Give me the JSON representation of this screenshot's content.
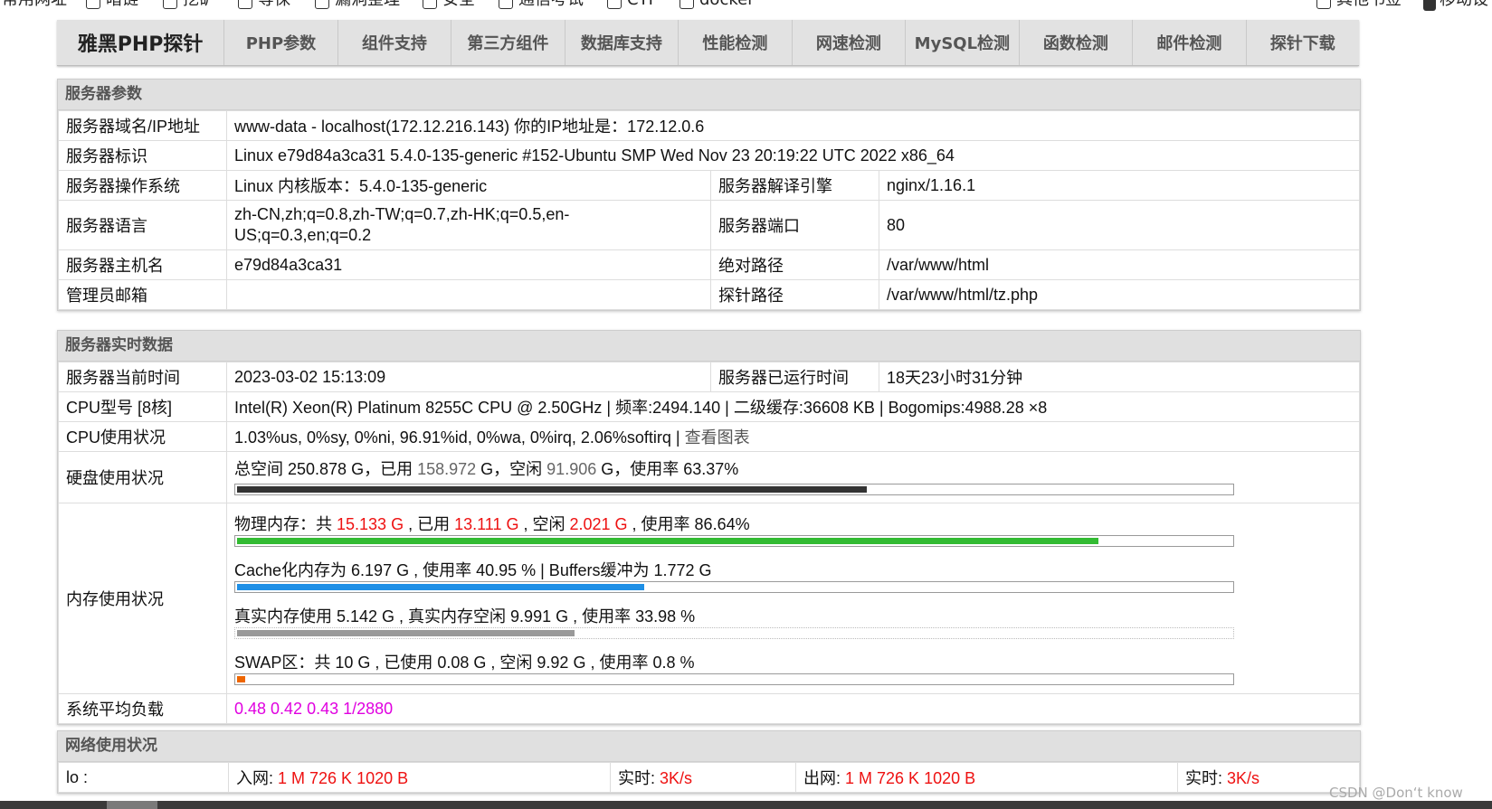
{
  "bookmarks": {
    "items": [
      "常用网址",
      "暗链",
      "挖矿",
      "等保",
      "漏洞整理",
      "安全",
      "通信考试",
      "CTF",
      "docker"
    ],
    "other": "其他书签",
    "mobile": "移动设"
  },
  "nav": {
    "brand": "雅黑PHP探针",
    "tabs": [
      "PHP参数",
      "组件支持",
      "第三方组件",
      "数据库支持",
      "性能检测",
      "网速检测",
      "MySQL检测",
      "函数检测",
      "邮件检测",
      "探针下载"
    ]
  },
  "server_params": {
    "title": "服务器参数",
    "domain_label": "服务器域名/IP地址",
    "domain_value": "www-data - localhost(172.12.216.143)  你的IP地址是：172.12.0.6",
    "id_label": "服务器标识",
    "id_value": "Linux e79d84a3ca31 5.4.0-135-generic #152-Ubuntu SMP Wed Nov 23 20:19:22 UTC 2022 x86_64",
    "os_label": "服务器操作系统",
    "os_value": "Linux  内核版本：5.4.0-135-generic",
    "engine_label": "服务器解译引擎",
    "engine_value": "nginx/1.16.1",
    "lang_label": "服务器语言",
    "lang_value": "zh-CN,zh;q=0.8,zh-TW;q=0.7,zh-HK;q=0.5,en-US;q=0.3,en;q=0.2",
    "port_label": "服务器端口",
    "port_value": "80",
    "host_label": "服务器主机名",
    "host_value": "e79d84a3ca31",
    "abspath_label": "绝对路径",
    "abspath_value": "/var/www/html",
    "email_label": "管理员邮箱",
    "email_value": "",
    "probepath_label": "探针路径",
    "probepath_value": "/var/www/html/tz.php"
  },
  "realtime": {
    "title": "服务器实时数据",
    "time_label": "服务器当前时间",
    "time_value": "2023-03-02 15:13:09",
    "uptime_label": "服务器已运行时间",
    "uptime_value": "18天23小时31分钟",
    "cpu_model_label": "CPU型号 [8核]",
    "cpu_model_value": "Intel(R) Xeon(R) Platinum 8255C CPU @ 2.50GHz | 频率:2494.140 | 二级缓存:36608 KB | Bogomips:4988.28 ×8",
    "cpu_usage_label": "CPU使用状况",
    "cpu_usage_value": "1.03%us, 0%sy, 0%ni, 96.91%id, 0%wa, 0%irq, 2.06%softirq | ",
    "cpu_chart_link": "查看图表",
    "disk_label": "硬盘使用状况",
    "disk_total": "总空间 250.878 G，已用 ",
    "disk_used": "158.972",
    "disk_free_pre": " G，空闲 ",
    "disk_free": "91.906",
    "disk_rate": " G，使用率 63.37%",
    "disk_fill": 0.6337,
    "mem_label": "内存使用状况",
    "mem_phys_pre": "物理内存：共 ",
    "mem_total": "15.133 G",
    "mem_used_pre": " , 已用 ",
    "mem_used": "13.111 G",
    "mem_free_pre": " , 空闲 ",
    "mem_free": "2.021 G",
    "mem_rate": " , 使用率 86.64%",
    "mem_fill": 0.8664,
    "cache_text": "Cache化内存为 6.197 G , 使用率 40.95 % | Buffers缓冲为 1.772 G",
    "cache_fill": 0.4095,
    "real_text": "真实内存使用 5.142 G , 真实内存空闲 9.991 G , 使用率 33.98 %",
    "real_fill": 0.3398,
    "swap_text": "SWAP区：共 10 G , 已使用 0.08 G , 空闲 9.92 G , 使用率 0.8 %",
    "swap_fill": 0.008,
    "load_label": "系统平均负载",
    "load_value": "0.48 0.42 0.43 1/2880"
  },
  "network": {
    "title": "网络使用状况",
    "rows": [
      {
        "iface": "lo :",
        "in_label": "入网: ",
        "in_value": "1 M 726 K 1020 B",
        "rt1_label": "实时: ",
        "rt1_value": "3K/s",
        "out_label": "出网: ",
        "out_value": "1 M 726 K 1020 B",
        "rt2_label": "实时: ",
        "rt2_value": "3K/s"
      }
    ]
  },
  "colors": {
    "disk_bar": "#333333",
    "mem_bar": "#33bb33",
    "cache_bar": "#1e8fe6",
    "real_bar": "#999999",
    "swap_bar": "#ee6600"
  },
  "watermark": "CSDN @Don‘t know"
}
